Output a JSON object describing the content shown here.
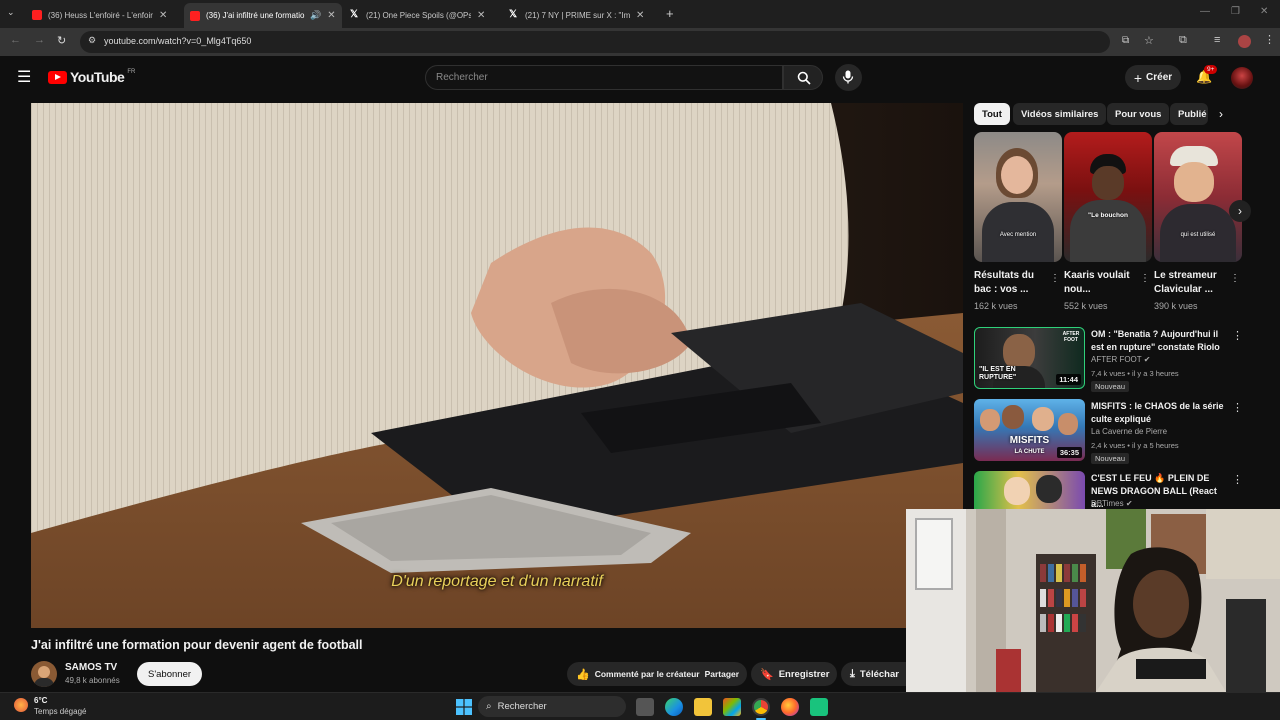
{
  "browser": {
    "tabs": [
      {
        "title": "(36) Heuss L'enfoiré - L'enfoiré",
        "icon": "youtube-icon",
        "active": false
      },
      {
        "title": "(36) J'ai infiltré une formatio",
        "icon": "youtube-icon",
        "active": true
      },
      {
        "title": "(21) One Piece Spoils (@OPspo",
        "icon": "x-icon",
        "active": false
      },
      {
        "title": "(21) 7 NY | PRIME sur X : \"Ims",
        "icon": "x-icon",
        "active": false
      }
    ],
    "url": "youtube.com/watch?v=0_Mlg4Tq650"
  },
  "youtube": {
    "logo_text": "YouTube",
    "logo_region": "FR",
    "search_placeholder": "Rechercher",
    "create_label": "Créer",
    "notif_count": "9+"
  },
  "video": {
    "subtitle": "D'un reportage et d'un narratif",
    "title": "J'ai infiltré une formation pour devenir agent de football",
    "channel": "SAMOS TV",
    "subscribers": "49,8 k abonnés",
    "subscribe_label": "S'abonner",
    "overlay_text": "Commenté par le créateur",
    "share_label": "Partager",
    "save_label": "Enregistrer",
    "download_label": "Téléchar"
  },
  "chips": [
    "Tout",
    "Vidéos similaires",
    "Pour vous",
    "Publié"
  ],
  "shorts": [
    {
      "title": "Résultats du bac : vos ...",
      "views": "162 k vues",
      "overlay": "Avec mention"
    },
    {
      "title": "Kaaris voulait nou...",
      "views": "552 k vues",
      "overlay": "\"Le bouchon"
    },
    {
      "title": "Le streameur Clavicular ...",
      "views": "390 k vues",
      "overlay": "qui est utilisé"
    }
  ],
  "recommendations": [
    {
      "title": "OM : \"Benatia ? Aujourd'hui il est en rupture\" constate Riolo",
      "channel": "AFTER FOOT",
      "meta": "7,4 k vues • il y a 3 heures",
      "duration": "11:44",
      "badge": "Nouveau",
      "thumb_text": "\"IL EST EN RUPTURE\"",
      "thumb_logo": "AFTER FOOT"
    },
    {
      "title": "MISFITS : le CHAOS de la série culte expliqué",
      "channel": "La Caverne de Pierre",
      "meta": "2,4 k vues • il y a 5 heures",
      "duration": "36:35",
      "badge": "Nouveau",
      "thumb_text": "MISFITS",
      "thumb_sub": "LA CHUTE"
    },
    {
      "title": "C'EST LE FEU 🔥 PLEIN DE NEWS DRAGON BALL (React a...",
      "channel": "DBTimes",
      "meta": "",
      "duration": "",
      "badge": ""
    }
  ],
  "taskbar": {
    "temp": "6°C",
    "weather": "Temps dégagé",
    "search_label": "Rechercher"
  },
  "colors": {
    "youtube_red": "#ff0000",
    "background": "#0f0f0f",
    "subtitle_yellow": "#e8d05a"
  }
}
